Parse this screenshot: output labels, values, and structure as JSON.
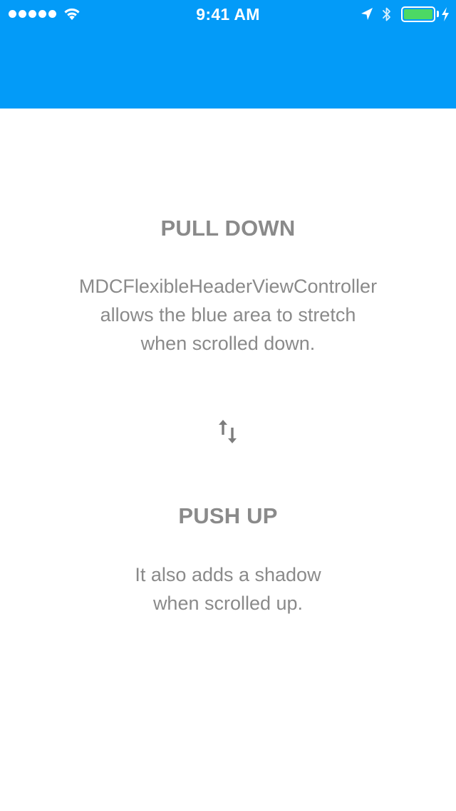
{
  "status_bar": {
    "time": "9:41 AM",
    "battery_color": "#4CD964"
  },
  "header": {
    "color": "#039BF8"
  },
  "pull_section": {
    "title": "PULL DOWN",
    "lines": [
      "MDCFlexibleHeaderViewController",
      "allows the blue area to stretch",
      "when scrolled down."
    ]
  },
  "divider_icon": "up-down-arrows-icon",
  "push_section": {
    "title": "PUSH UP",
    "lines": [
      "It also adds a shadow",
      "when scrolled up."
    ]
  },
  "text_color": "#8a8a8a"
}
